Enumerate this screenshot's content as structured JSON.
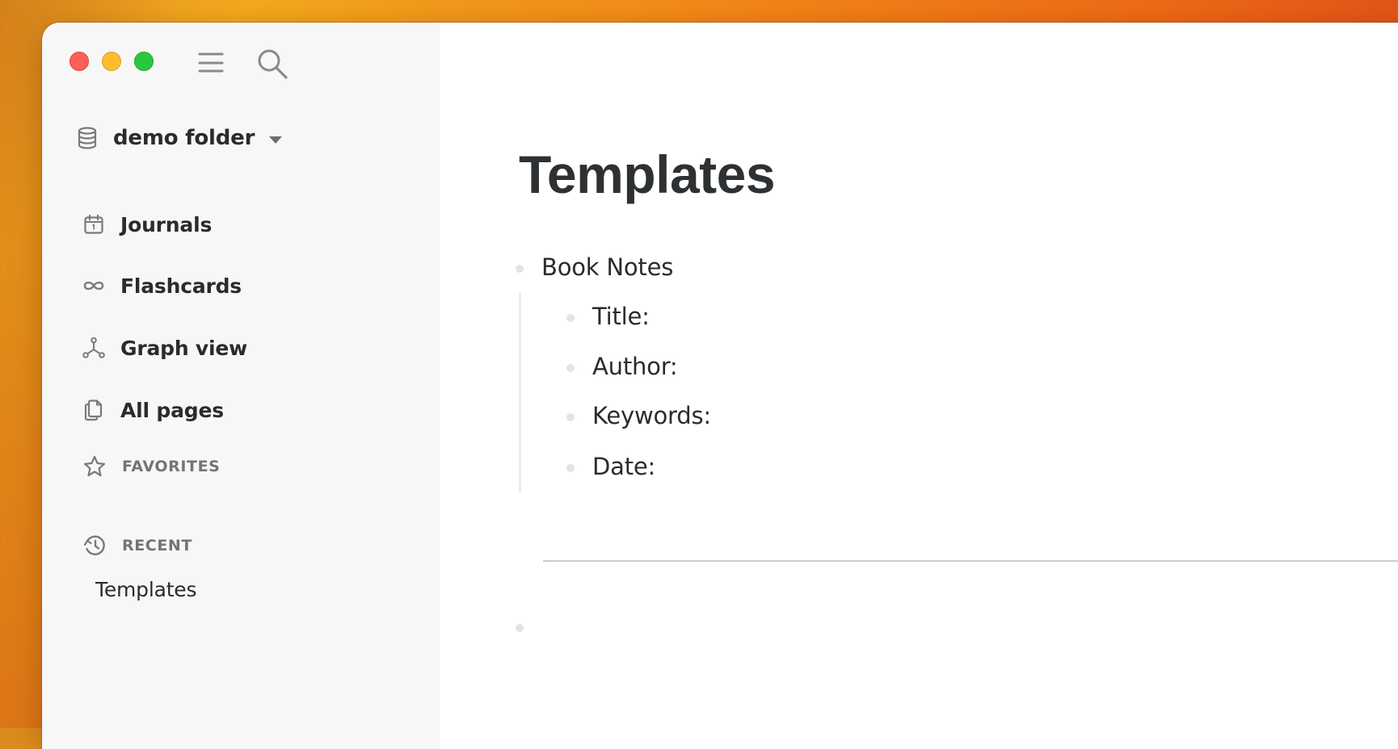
{
  "window": {
    "traffic_lights": [
      {
        "name": "close",
        "color": "#fe5f57"
      },
      {
        "name": "minimize",
        "color": "#febc2e"
      },
      {
        "name": "zoom",
        "color": "#28c840"
      }
    ]
  },
  "toolbar": {
    "menu_icon": "hamburger-menu-icon",
    "search_icon": "search-icon"
  },
  "sidebar": {
    "folder": {
      "icon": "database-icon",
      "label": "demo folder",
      "dropdown_icon": "caret-down-icon"
    },
    "nav_items": [
      {
        "icon": "calendar-icon",
        "label": "Journals"
      },
      {
        "icon": "infinity-icon",
        "label": "Flashcards"
      },
      {
        "icon": "graph-icon",
        "label": "Graph view"
      },
      {
        "icon": "pages-icon",
        "label": "All pages"
      }
    ],
    "sections": [
      {
        "icon": "star-icon",
        "label": "FAVORITES"
      },
      {
        "icon": "history-icon",
        "label": "RECENT"
      }
    ],
    "recent_items": [
      {
        "label": "Templates"
      }
    ]
  },
  "main": {
    "page_title": "Templates",
    "blocks": [
      {
        "text": "Book Notes",
        "children": [
          {
            "text": "Title:"
          },
          {
            "text": "Author:"
          },
          {
            "text": "Keywords:"
          },
          {
            "text": "Date:"
          }
        ]
      }
    ],
    "empty_block": ""
  },
  "colors": {
    "sidebar_bg": "#f7f7f7",
    "main_bg": "#ffffff",
    "text": "#2b2b2b",
    "title": "#2e3133",
    "muted": "#747474",
    "bullet": "#e3e3e3"
  }
}
